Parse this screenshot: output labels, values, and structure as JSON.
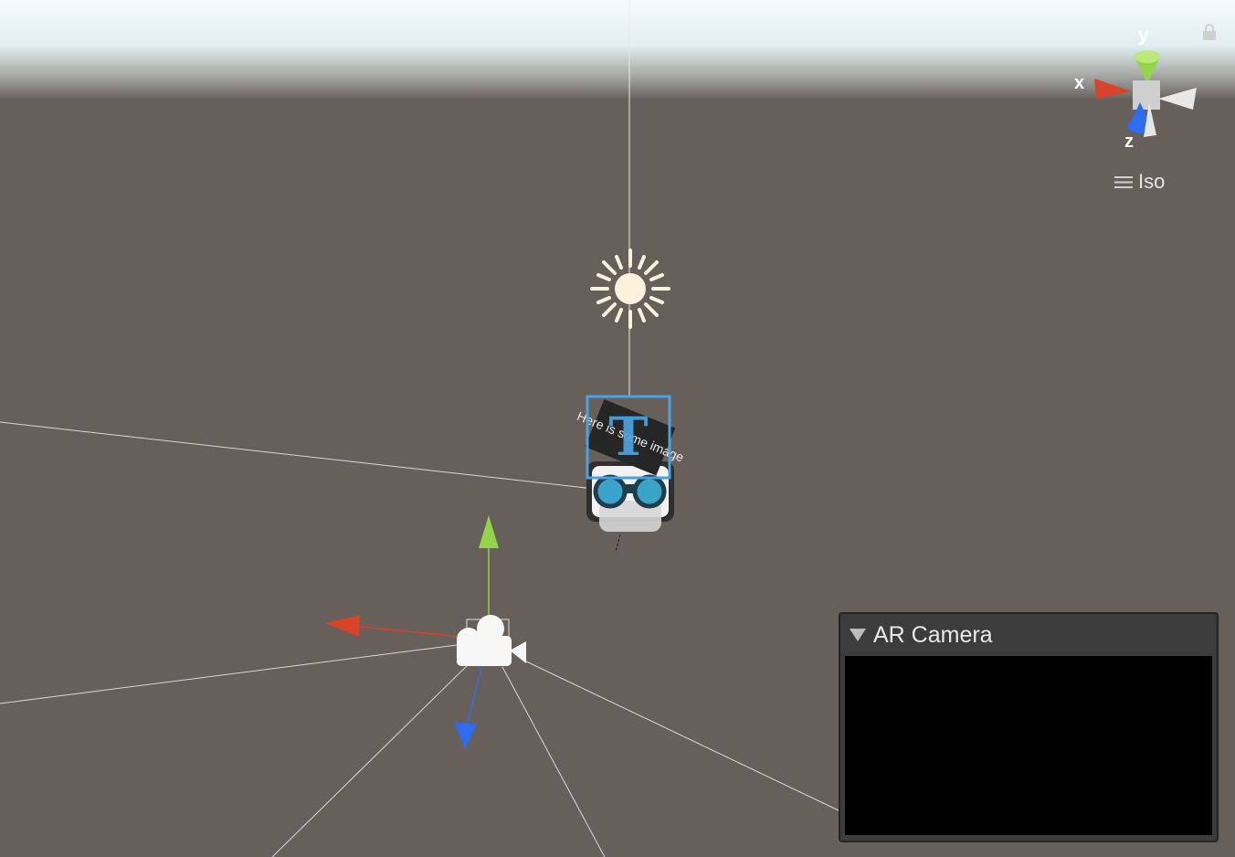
{
  "scene_view": {
    "sky_color": "#f4fbfd",
    "ground_color": "#675f5a",
    "lock_icon": "lock-icon",
    "orientation_gizmo": {
      "x_label": "x",
      "y_label": "y",
      "z_label": "z",
      "x_color": "#d8432a",
      "y_color": "#93d44a",
      "z_color": "#2f6cf0",
      "projection_label": "Iso",
      "projection_icon": "hamburger-icon"
    },
    "objects": [
      {
        "name": "Directional Light",
        "icon": "sun-icon"
      },
      {
        "name": "Text",
        "icon": "text-icon",
        "text_label": "T",
        "text_content": "Here is some image"
      },
      {
        "name": "Character",
        "icon": "binoculars-icon"
      },
      {
        "name": "AR Camera",
        "icon": "camera-icon"
      }
    ],
    "move_handle_colors": {
      "x": "#d8432a",
      "y": "#93d44a",
      "z": "#2f6cf0"
    }
  },
  "camera_preview": {
    "title": "AR Camera",
    "expand_icon": "triangle-down-icon"
  }
}
